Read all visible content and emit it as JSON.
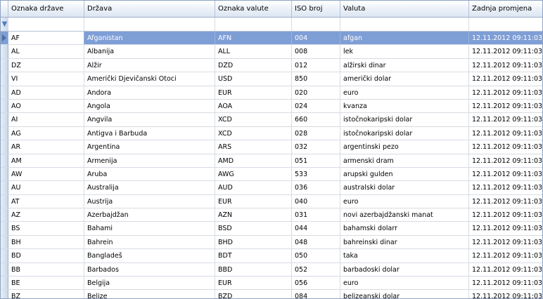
{
  "columns": [
    "Oznaka države",
    "Država",
    "Oznaka valute",
    "ISO broj",
    "Valuta",
    "Zadnja promjena"
  ],
  "rows": [
    [
      "AF",
      "Afganistan",
      "AFN",
      "004",
      "afgan",
      "12.11.2012 09:11:03"
    ],
    [
      "AL",
      "Albanija",
      "ALL",
      "008",
      "lek",
      "12.11.2012 09:11:03"
    ],
    [
      "DZ",
      "Alžir",
      "DZD",
      "012",
      "alžirski dinar",
      "12.11.2012 09:11:03"
    ],
    [
      "VI",
      "Američki Djevičanski Otoci",
      "USD",
      "850",
      "američki dolar",
      "12.11.2012 09:11:03"
    ],
    [
      "AD",
      "Andora",
      "EUR",
      "020",
      "euro",
      "12.11.2012 09:11:03"
    ],
    [
      "AO",
      "Angola",
      "AOA",
      "024",
      "kvanza",
      "12.11.2012 09:11:03"
    ],
    [
      "AI",
      "Angvila",
      "XCD",
      "660",
      "istočnokaripski dolar",
      "12.11.2012 09:11:03"
    ],
    [
      "AG",
      "Antigva i Barbuda",
      "XCD",
      "028",
      "istočnokaripski dolar",
      "12.11.2012 09:11:03"
    ],
    [
      "AR",
      "Argentina",
      "ARS",
      "032",
      "argentinski pezo",
      "12.11.2012 09:11:03"
    ],
    [
      "AM",
      "Armenija",
      "AMD",
      "051",
      "armenski dram",
      "12.11.2012 09:11:03"
    ],
    [
      "AW",
      "Aruba",
      "AWG",
      "533",
      "arupski gulden",
      "12.11.2012 09:11:03"
    ],
    [
      "AU",
      "Australija",
      "AUD",
      "036",
      "australski dolar",
      "12.11.2012 09:11:03"
    ],
    [
      "AT",
      "Austrija",
      "EUR",
      "040",
      "euro",
      "12.11.2012 09:11:03"
    ],
    [
      "AZ",
      "Azerbajdžan",
      "AZN",
      "031",
      "novi azerbajdžanski manat",
      "12.11.2012 09:11:03"
    ],
    [
      "BS",
      "Bahami",
      "BSD",
      "044",
      "bahamski dolarr",
      "12.11.2012 09:11:03"
    ],
    [
      "BH",
      "Bahrein",
      "BHD",
      "048",
      "bahreinski dinar",
      "12.11.2012 09:11:03"
    ],
    [
      "BD",
      "Bangladeš",
      "BDT",
      "050",
      "taka",
      "12.11.2012 09:11:03"
    ],
    [
      "BB",
      "Barbados",
      "BBD",
      "052",
      "barbadoski dolar",
      "12.11.2012 09:11:03"
    ],
    [
      "BE",
      "Belgija",
      "EUR",
      "056",
      "euro",
      "12.11.2012 09:11:03"
    ],
    [
      "BZ",
      "Belize",
      "BZD",
      "084",
      "belizeanski dolar",
      "12.11.2012 09:11:03"
    ]
  ],
  "selected_row": 0,
  "icons": {
    "filter_row": "filter-icon",
    "row_indicator": "current-row-arrow-icon"
  },
  "colors": {
    "selection": "#7e9ed6",
    "header_bottom": "#dbe5f2",
    "grid_line": "#d6dbe3"
  }
}
